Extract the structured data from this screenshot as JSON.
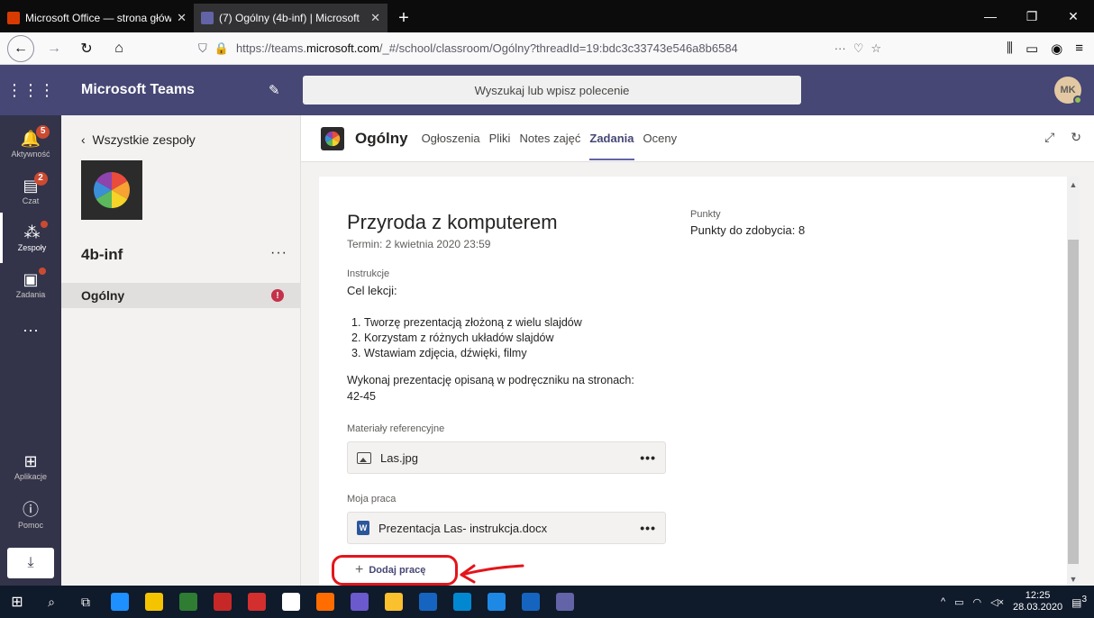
{
  "browser": {
    "tabs": [
      {
        "title": "Microsoft Office — strona głów",
        "close": "✕",
        "favicon_color": "#d83b01",
        "active": false
      },
      {
        "title": "(7) Ogólny (4b-inf) | Microsoft",
        "close": "✕",
        "favicon_color": "#6264a7",
        "active": true
      }
    ],
    "new_tab": "+",
    "window_controls": [
      "—",
      "❐",
      "✕"
    ],
    "url_prefix": "https://teams.",
    "url_domain": "microsoft.com",
    "url_rest": "/_#/school/classroom/Ogólny?threadId=19:bdc3c33743e546a8b6584",
    "page_actions": "···"
  },
  "teams": {
    "app_name": "Microsoft Teams",
    "search_placeholder": "Wyszukaj lub wpisz polecenie",
    "avatar_initials": "MK"
  },
  "rail": [
    {
      "label": "Aktywność",
      "badge": "5",
      "icon": "bell-icon",
      "glyph": "🔔"
    },
    {
      "label": "Czat",
      "badge": "2",
      "icon": "chat-icon",
      "glyph": "▤"
    },
    {
      "label": "Zespoły",
      "badge": "",
      "icon": "teams-icon",
      "glyph": "⁂",
      "active": true
    },
    {
      "label": "Zadania",
      "badge": "",
      "icon": "assignments-icon",
      "glyph": "🎒"
    },
    {
      "label": "",
      "icon": "more-icon",
      "glyph": "···"
    },
    {
      "label": "Aplikacje",
      "icon": "apps-icon",
      "glyph": "⊞"
    },
    {
      "label": "Pomoc",
      "icon": "help-icon",
      "glyph": "?"
    }
  ],
  "team_panel": {
    "back_label": "Wszystkie zespoły",
    "team_name": "4b-inf",
    "more": "···",
    "channel": "Ogólny",
    "channel_badge": "!"
  },
  "channel_header": {
    "name": "Ogólny",
    "tabs": [
      "Ogłoszenia",
      "Pliki",
      "Notes zajęć",
      "Zadania",
      "Oceny"
    ],
    "active_tab": "Zadania"
  },
  "assignment": {
    "title": "Przyroda z komputerem",
    "due": "Termin: 2 kwietnia 2020 23:59",
    "instructions_label": "Instrukcje",
    "goal": "Cel lekcji:",
    "goals": [
      {
        "num": "1.",
        "text": "Tworzę prezentacją złożoną z wielu slajdów"
      },
      {
        "num": "2.",
        "text": "Korzystam z różnych układów slajdów"
      },
      {
        "num": "3.",
        "text": "Wstawiam zdjęcia, dźwięki, filmy"
      }
    ],
    "task_line1": "Wykonaj prezentację opisaną w podręczniku na stronach:",
    "task_line2": "42-45",
    "reference_label": "Materiały referencyjne",
    "reference_file": "Las.jpg",
    "my_work_label": "Moja praca",
    "my_work_file": "Prezentacja Las- instrukcja.docx",
    "file_more": "•••",
    "add_work": "Dodaj pracę",
    "points_label": "Punkty",
    "points_value": "Punkty do zdobycia: 8"
  },
  "taskbar": {
    "time": "12:25",
    "date": "28.03.2020",
    "notifications": "3",
    "icon_colors": [
      "#1e90ff",
      "#f5c400",
      "#2e7d32",
      "#c62828",
      "#d32f2f",
      "#ffffff",
      "#ff6d00",
      "#6a5acd",
      "#fbc02d",
      "#1565c0",
      "#0288d1",
      "#1e88e5",
      "#1565c0",
      "#6264a7"
    ]
  },
  "colors": {
    "teams_header": "#464775",
    "rail": "#33344a",
    "accent": "#6264a7",
    "annotation": "#e3151b"
  }
}
